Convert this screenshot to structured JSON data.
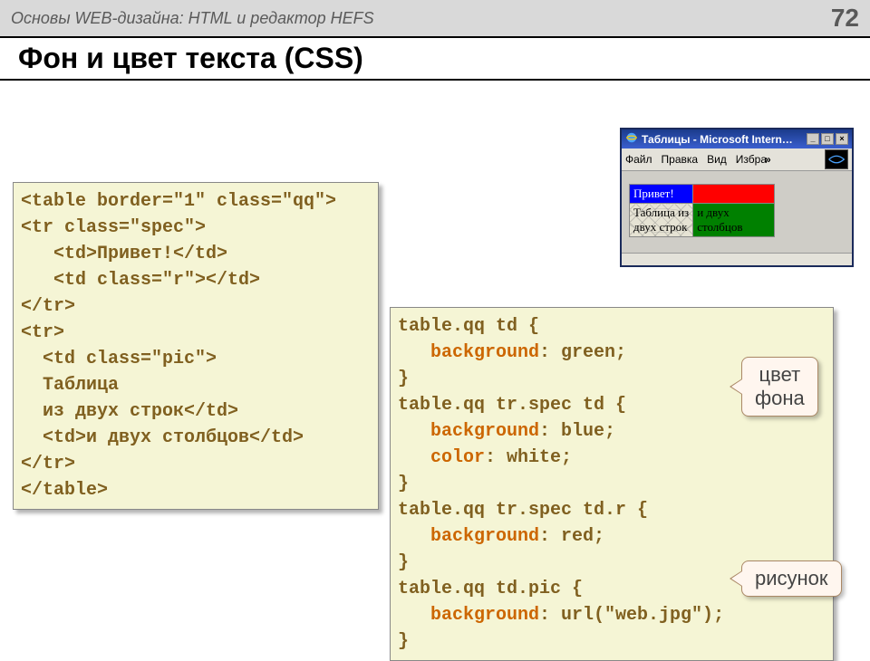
{
  "header": {
    "course": "Основы WEB-дизайна: HTML и редактор HEFS",
    "page_number": "72"
  },
  "title": "Фон и цвет текста (CSS)",
  "code_left": {
    "lines": [
      "<table border=\"1\" class=\"qq\">",
      "<tr class=\"spec\">",
      "   <td>Привет!</td>",
      "   <td class=\"r\"></td>",
      "</tr>",
      "<tr>",
      "  <td class=\"pic\">",
      "  Таблица",
      "  из двух строк</td>",
      "  <td>и двух столбцов</td>",
      "</tr>",
      "</table>"
    ]
  },
  "code_right": {
    "l1": "table.qq td {",
    "l2a": "   background",
    "l2b": ": green;",
    "l3": "}",
    "l4": "table.qq tr.spec td {",
    "l5a": "   background",
    "l5b": ": blue;",
    "l6a": "   color",
    "l6b": ": white;",
    "l7": "}",
    "l8": "table.qq tr.spec td.r {",
    "l9a": "   background",
    "l9b": ": red;",
    "l10": "}",
    "l11": "table.qq td.pic {",
    "l12a": "   background",
    "l12b": ": url(\"web.jpg\");",
    "l13": "}"
  },
  "callouts": {
    "bg_color_line1": "цвет",
    "bg_color_line2": "фона",
    "image": "рисунок"
  },
  "browser": {
    "title": "Таблицы - Microsoft Intern…",
    "menu": {
      "file": "Файл",
      "edit": "Правка",
      "view": "Вид",
      "fav": "Избра",
      "more": "»"
    },
    "table": {
      "r1c1": "Привет!",
      "r1c2": "",
      "r2c1": "Таблица из\nдвух строк",
      "r2c2": "и двух\nстолбцов"
    }
  }
}
